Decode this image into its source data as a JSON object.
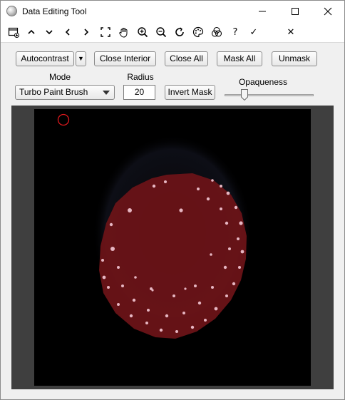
{
  "window": {
    "title": "Data Editing Tool",
    "minimize_glyph": "—",
    "maximize_glyph": "☐",
    "close_glyph": "✕"
  },
  "toolbar": {
    "help_label": "?",
    "apply_label": "✓",
    "cancel_label": "✕",
    "icons": [
      "new-window-icon",
      "chevron-up-icon",
      "chevron-down-icon",
      "chevron-left-icon",
      "chevron-right-icon",
      "fit-screen-icon",
      "pan-hand-icon",
      "zoom-in-icon",
      "zoom-out-icon",
      "rotate-icon",
      "palette-icon",
      "color-channels-icon",
      "help-icon",
      "apply-check-icon",
      "cancel-x-icon"
    ]
  },
  "controls": {
    "autocontrast_label": "Autocontrast",
    "autocontrast_menu_glyph": "▼",
    "close_interior_label": "Close Interior",
    "close_all_label": "Close All",
    "mask_all_label": "Mask All",
    "unmask_label": "Unmask",
    "mode_label": "Mode",
    "mode_value": "Turbo Paint Brush",
    "radius_label": "Radius",
    "radius_value": "20",
    "invert_mask_label": "Invert Mask",
    "opaqueness_label": "Opaqueness",
    "opaqueness_level": 0.2
  },
  "viewer": {
    "mask_color": "#6e1318",
    "brush_cursor_color": "#e0191e",
    "background_color": "#000000",
    "frame_color": "#3f3f3f"
  }
}
